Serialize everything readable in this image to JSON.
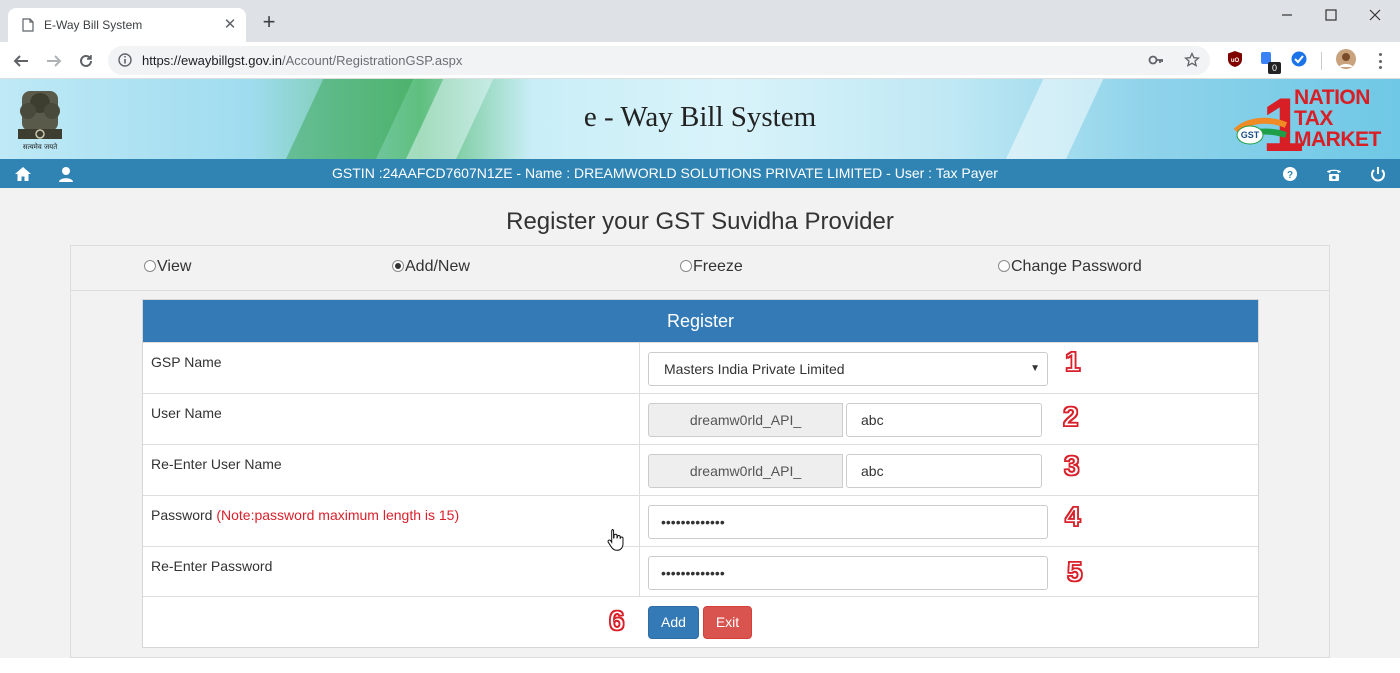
{
  "browser": {
    "tab_title": "E-Way Bill System",
    "url_host": "https://ewaybillgst.gov.in",
    "url_path": "/Account/RegistrationGSP.aspx",
    "extension_badge": "0"
  },
  "header": {
    "site_title": "e - Way Bill System",
    "emblem_caption": "सत्यमेव जयते",
    "gst_logo_text": "NATION TAX MARKET",
    "gst_logo_badge": "GST",
    "gst_logo_numeral": "1",
    "user_info": "GSTIN :24AAFCD7607N1ZE - Name : DREAMWORLD SOLUTIONS PRIVATE LIMITED - User : Tax Payer"
  },
  "page": {
    "title": "Register your GST Suvidha Provider",
    "radio_options": [
      {
        "label": "View",
        "selected": false
      },
      {
        "label": "Add/New",
        "selected": true
      },
      {
        "label": "Freeze",
        "selected": false
      },
      {
        "label": "Change Password",
        "selected": false
      }
    ]
  },
  "form": {
    "heading": "Register",
    "gsp_name_label": "GSP Name",
    "gsp_name_value": "Masters India Private Limited",
    "user_name_label": "User Name",
    "user_name_prefix": "dreamw0rld_API_",
    "user_name_value": "abc",
    "reenter_user_name_label": "Re-Enter User Name",
    "reenter_user_name_prefix": "dreamw0rld_API_",
    "reenter_user_name_value": "abc",
    "password_label": "Password",
    "password_note": "(Note:password maximum length is 15)",
    "password_value": "•••••••••••••",
    "reenter_password_label": "Re-Enter Password",
    "reenter_password_value": "•••••••••••••",
    "add_button": "Add",
    "exit_button": "Exit"
  },
  "annotations": {
    "step1": "1",
    "step2": "2",
    "step3": "3",
    "step4": "4",
    "step5": "5",
    "step6": "6"
  },
  "colors": {
    "primary": "#337ab7",
    "danger": "#d9534f",
    "userbar": "#2f84b4",
    "note_red": "#d9212b"
  }
}
